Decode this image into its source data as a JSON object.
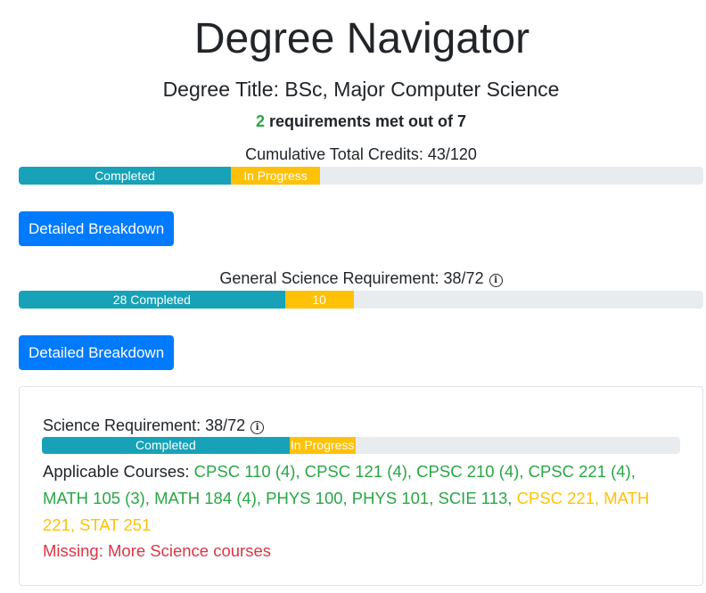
{
  "header": {
    "title": "Degree Navigator",
    "degree_title": "Degree Title: BSc, Major Computer Science",
    "requirements_met_count": "2",
    "requirements_met_text": " requirements met out of 7"
  },
  "cumulative": {
    "label": "Cumulative Total Credits: 43/120",
    "completed_label": "Completed",
    "in_progress_label": "In Progress",
    "completed_fraction": 0.31,
    "in_progress_fraction": 0.13
  },
  "buttons": {
    "detailed_breakdown_1": "Detailed Breakdown",
    "detailed_breakdown_2": "Detailed Breakdown"
  },
  "general_science": {
    "label": "General Science Requirement: 38/72",
    "info_icon": "info-circle-icon",
    "completed_label": "28 Completed",
    "in_progress_label": "10",
    "completed_fraction": 0.389,
    "in_progress_fraction": 0.1
  },
  "science_card": {
    "label": "Science Requirement: 38/72",
    "info_icon": "info-circle-icon",
    "completed_label": "Completed",
    "in_progress_label": "In Progress",
    "completed_fraction": 0.388,
    "in_progress_fraction": 0.103,
    "applicable_label": "Applicable Courses: ",
    "completed_courses": "CPSC 110 (4), CPSC 121 (4), CPSC 210 (4), CPSC 221 (4), MATH 105 (3), MATH 184 (4), PHYS 100, PHYS 101, SCIE 113, ",
    "in_progress_courses": "CPSC 221, MATH 221, STAT 251",
    "missing": "Missing: More Science courses"
  },
  "colors": {
    "completed": "#17a2b8",
    "in_progress": "#ffc107",
    "met_count": "#28a745",
    "button": "#007bff",
    "missing": "#dc3545",
    "track": "#e9ecef"
  }
}
